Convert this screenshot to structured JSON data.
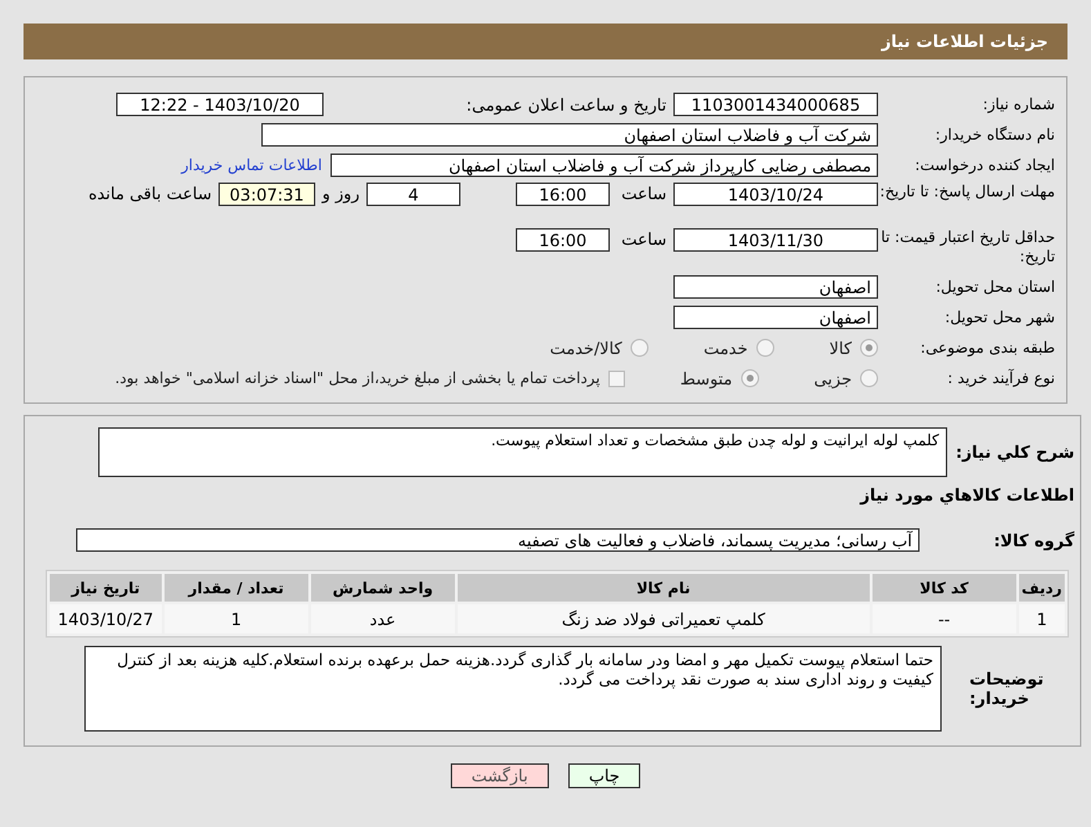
{
  "header": {
    "title": "جزئیات اطلاعات نیاز"
  },
  "need_number": {
    "label": "شماره نیاز:",
    "value": "1103001434000685"
  },
  "announce": {
    "label": "تاریخ و ساعت اعلان عمومی:",
    "value": "1403/10/20 - 12:22"
  },
  "buyer_org": {
    "label": "نام دستگاه خریدار:",
    "value": "شرکت آب و فاضلاب استان اصفهان"
  },
  "requester": {
    "label": "ایجاد کننده درخواست:",
    "value": "مصطفی رضایی کارپرداز شرکت آب و فاضلاب استان اصفهان",
    "link": "اطلاعات تماس خریدار"
  },
  "reply_deadline": {
    "label": "مهلت ارسال پاسخ: تا تاریخ:",
    "date": "1403/10/24",
    "time_label": "ساعت",
    "time": "16:00",
    "days": "4",
    "days_label": "روز و",
    "remaining": "03:07:31",
    "remaining_label": "ساعت باقی مانده"
  },
  "price_validity": {
    "label": "حداقل تاریخ اعتبار قیمت: تا تاریخ:",
    "date": "1403/11/30",
    "time_label": "ساعت",
    "time": "16:00"
  },
  "province": {
    "label": "استان محل تحویل:",
    "value": "اصفهان"
  },
  "city": {
    "label": "شهر محل تحویل:",
    "value": "اصفهان"
  },
  "category": {
    "label": "طبقه بندی موضوعی:",
    "options": [
      {
        "label": "کالا",
        "selected": true
      },
      {
        "label": "خدمت",
        "selected": false
      },
      {
        "label": "کالا/خدمت",
        "selected": false
      }
    ]
  },
  "process": {
    "label": "نوع فرآیند خرید :",
    "options": [
      {
        "label": "جزیی",
        "selected": false
      },
      {
        "label": "متوسط",
        "selected": true
      }
    ],
    "payment": {
      "label": "پرداخت تمام یا بخشی از مبلغ خرید،از محل \"اسناد خزانه اسلامی\" خواهد بود.",
      "checked": false
    }
  },
  "description": {
    "label": "شرح کلي نياز:",
    "value": "کلمپ لوله ایرانیت و لوله چدن طبق مشخصات و تعداد استعلام پیوست."
  },
  "items_title": "اطلاعات کالاهاي مورد نياز",
  "goods_group": {
    "label": "گروه کالا:",
    "value": "آب رسانی؛ مدیریت پسماند، فاضلاب و فعالیت های تصفیه"
  },
  "table": {
    "columns": [
      "ردیف",
      "کد کالا",
      "نام کالا",
      "واحد شمارش",
      "تعداد / مقدار",
      "تاریخ نیاز"
    ],
    "rows": [
      [
        "1",
        "--",
        "کلمپ تعمیراتی فولاد ضد زنگ",
        "عدد",
        "1",
        "1403/10/27"
      ]
    ]
  },
  "buyer_notes": {
    "label": "توضیحات خریدار:",
    "value": "حتما استعلام پیوست تکمیل مهر و امضا ودر سامانه بار گذاری گردد.هزینه حمل برعهده برنده استعلام.کلیه هزینه بعد از کنترل کیفیت و روند اداری سند به صورت نقد پرداخت می گردد."
  },
  "buttons": [
    {
      "label": "چاپ",
      "kind": "print"
    },
    {
      "label": "بازگشت",
      "kind": "back"
    }
  ]
}
